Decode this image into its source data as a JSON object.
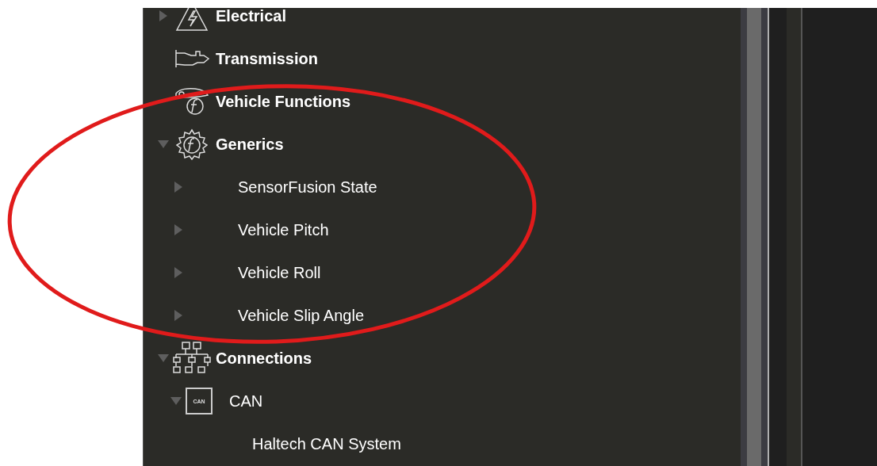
{
  "tree": [
    {
      "label": "Electrical",
      "kind": "electrical",
      "expanded": false
    },
    {
      "label": "Transmission",
      "kind": "transmission"
    },
    {
      "label": "Vehicle Functions",
      "kind": "vehicle-function"
    },
    {
      "label": "Generics",
      "kind": "generic-function",
      "expanded": true,
      "children": [
        {
          "label": "SensorFusion State",
          "kind": "channel",
          "expanded": false
        },
        {
          "label": "Vehicle Pitch",
          "kind": "channel",
          "expanded": false
        },
        {
          "label": "Vehicle Roll",
          "kind": "channel",
          "expanded": false
        },
        {
          "label": "Vehicle Slip Angle",
          "kind": "channel",
          "expanded": false
        }
      ]
    },
    {
      "label": "Connections",
      "kind": "network",
      "expanded": true,
      "children": [
        {
          "label": "CAN",
          "kind": "bus",
          "icon_text": "CAN",
          "expanded": true,
          "children": [
            {
              "label": "Haltech CAN System",
              "kind": "device"
            }
          ]
        }
      ]
    }
  ],
  "annotation": {
    "kind": "ellipse",
    "color": "#e01b1b"
  }
}
